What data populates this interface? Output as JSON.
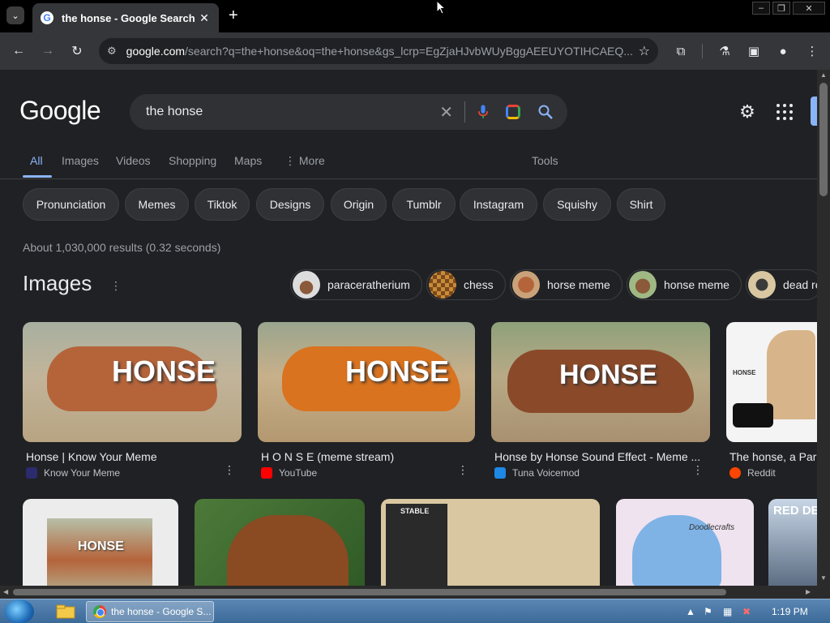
{
  "browser": {
    "tab_title": "the honse - Google Search",
    "tab_favicon": "G",
    "new_tab_symbol": "+",
    "url_host": "google.com",
    "url_rest": "/search?q=the+honse&oq=the+honse&gs_lcrp=EgZjaHJvbWUyBggAEEUYOTIHCAEQ..."
  },
  "google": {
    "logo": "Google",
    "query": "the honse",
    "nav_tabs": [
      "All",
      "Images",
      "Videos",
      "Shopping",
      "Maps",
      "More",
      "Tools"
    ],
    "chips": [
      "Pronunciation",
      "Memes",
      "Tiktok",
      "Designs",
      "Origin",
      "Tumblr",
      "Instagram",
      "Squishy",
      "Shirt"
    ],
    "stats": "About 1,030,000 results (0.32 seconds)",
    "images_heading": "Images",
    "image_chips": [
      "paraceratherium",
      "chess",
      "horse meme",
      "honse meme",
      "dead re"
    ],
    "cards": [
      {
        "title": "Honse | Know Your Meme",
        "source": "Know Your Meme",
        "overlay": "HONSE"
      },
      {
        "title": "H O N S E (meme stream)",
        "source": "YouTube",
        "overlay": "HONSE"
      },
      {
        "title": "Honse by Honse Sound Effect - Meme ...",
        "source": "Tuna Voicemod",
        "overlay": "HONSE"
      },
      {
        "title": "The honse, a Par",
        "source": "Reddit",
        "overlay": "HONSE"
      }
    ],
    "row2_overlays": [
      "HONSE",
      "STABLE",
      "Doodlecrafts",
      "RED DE"
    ]
  },
  "taskbar": {
    "task_label": "the honse - Google S...",
    "clock": "1:19 PM"
  },
  "colors": {
    "page_bg": "#202124",
    "link_blue": "#8ab4f8",
    "chip_bg": "#303134"
  }
}
